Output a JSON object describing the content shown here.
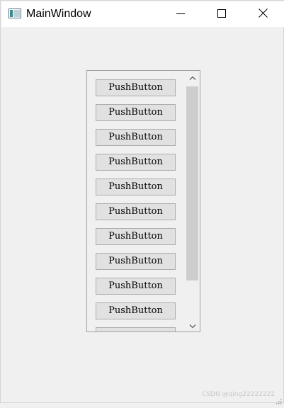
{
  "window": {
    "title": "MainWindow",
    "icons": {
      "app": "app-window-icon",
      "minimize": "minimize-icon",
      "maximize": "maximize-icon",
      "close": "close-icon"
    }
  },
  "scroll_area": {
    "buttons": [
      {
        "label": "PushButton"
      },
      {
        "label": "PushButton"
      },
      {
        "label": "PushButton"
      },
      {
        "label": "PushButton"
      },
      {
        "label": "PushButton"
      },
      {
        "label": "PushButton"
      },
      {
        "label": "PushButton"
      },
      {
        "label": "PushButton"
      },
      {
        "label": "PushButton"
      },
      {
        "label": "PushButton"
      },
      {
        "label": ""
      }
    ],
    "scrollbar": {
      "up_icon": "chevron-up-icon",
      "down_icon": "chevron-down-icon",
      "position_fraction": 0.0,
      "visible_fraction": 0.84
    }
  },
  "watermark": "CSDN @qing22222222"
}
